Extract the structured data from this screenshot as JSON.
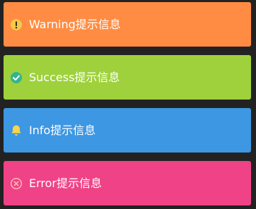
{
  "colors": {
    "background": "#222222",
    "warning": "#ff8c42",
    "success": "#9ed13c",
    "info": "#3d97e2",
    "error": "#f04287",
    "warning_icon_fill": "#f6c84a",
    "success_icon_fill": "#36b38f",
    "info_icon_fill": "#f6d54b",
    "error_icon_stroke": "#ffb0b0"
  },
  "alerts": [
    {
      "type": "warning",
      "icon": "exclamation-circle-icon",
      "text": "Warning提示信息"
    },
    {
      "type": "success",
      "icon": "check-circle-icon",
      "text": "Success提示信息"
    },
    {
      "type": "info",
      "icon": "bell-icon",
      "text": "Info提示信息"
    },
    {
      "type": "error",
      "icon": "close-circle-icon",
      "text": "Error提示信息"
    }
  ]
}
